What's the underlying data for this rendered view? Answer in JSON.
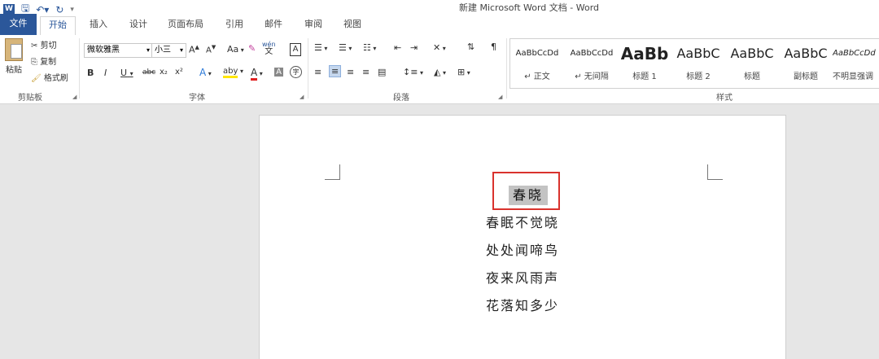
{
  "window": {
    "title": "新建 Microsoft Word 文档 - Word"
  },
  "tabs": [
    "文件",
    "开始",
    "插入",
    "设计",
    "页面布局",
    "引用",
    "邮件",
    "审阅",
    "视图"
  ],
  "clipboard": {
    "paste": "粘贴",
    "cut": "剪切",
    "copy": "复制",
    "format_painter": "格式刷",
    "label": "剪贴板"
  },
  "font": {
    "name": "微软雅黑",
    "size": "小三",
    "label": "字体",
    "grow": "A",
    "shrink": "A",
    "case": "Aa",
    "phonetic": "wén",
    "phonetic_char": "文",
    "border_char": "A",
    "bold": "B",
    "italic": "I",
    "underline": "U",
    "strike": "abc",
    "sub": "x₂",
    "sup": "x²",
    "effects": "A",
    "highlight": "aby",
    "color": "A",
    "shade": "A",
    "enclose": "字"
  },
  "paragraph": {
    "label": "段落"
  },
  "styles": {
    "label": "样式",
    "items": [
      {
        "sample": "AaBbCcDd",
        "name": "↵ 正文"
      },
      {
        "sample": "AaBbCcDd",
        "name": "↵ 无间隔"
      },
      {
        "sample": "AaBb",
        "name": "标题 1"
      },
      {
        "sample": "AaBbC",
        "name": "标题 2"
      },
      {
        "sample": "AaBbC",
        "name": "标题"
      },
      {
        "sample": "AaBbC",
        "name": "副标题"
      },
      {
        "sample": "AaBbCcDd",
        "name": "不明显强调"
      }
    ]
  },
  "document": {
    "title": "春晓",
    "lines": [
      "春眠不觉晓",
      "处处闻啼鸟",
      "夜来风雨声",
      "花落知多少"
    ]
  },
  "colors": {
    "accent": "#2b579a",
    "highlight_box": "#d9322d",
    "selection": "#c3c3c3"
  }
}
